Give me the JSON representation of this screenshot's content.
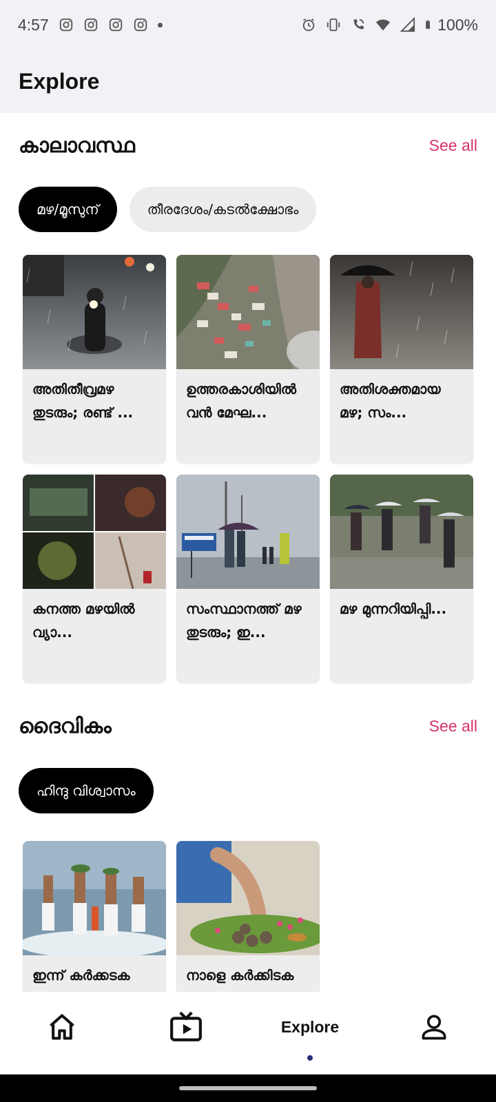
{
  "status_bar": {
    "time": "4:57",
    "notification_icons": [
      "instagram-icon",
      "instagram-icon",
      "instagram-icon",
      "instagram-icon"
    ],
    "system_icons": [
      "alarm-icon",
      "vibrate-icon",
      "wifi-calling-icon",
      "wifi-icon",
      "signal-icon",
      "battery-icon"
    ],
    "battery": "100%"
  },
  "header": {
    "title": "Explore"
  },
  "sections": [
    {
      "title": "കാലാവസ്ഥ",
      "see_all": "See all",
      "chips": [
        {
          "label": "മഴ/മൂസുന്",
          "active": true
        },
        {
          "label": "തീരദേശം/കടൽക്ഷോഭം",
          "active": false
        }
      ],
      "cards": [
        {
          "title": "അതിതീവ്രമഴ തുടരും; രണ്ട് ...",
          "image": "motorcycle-rider-in-rain"
        },
        {
          "title": "ഉത്തരകാശിയിൽ വൻ മേഘ...",
          "image": "hillside-village-landslide"
        },
        {
          "title": "അതിശക്തമായ മഴ; സം...",
          "image": "person-with-umbrella-in-rain"
        },
        {
          "title": "കനത്ത മഴയിൽ വ്യാ...",
          "image": "flood-damage-collage"
        },
        {
          "title": "സംസ്ഥാനത്ത് മഴ തുടരും; ഇ...",
          "image": "seashore-people-with-umbrellas"
        },
        {
          "title": "മഴ മുന്നറിയിപ്പി...",
          "image": "students-walking-in-rain"
        }
      ]
    },
    {
      "title": "ദൈവികം",
      "see_all": "See all",
      "chips": [
        {
          "label": "ഹിന്ദു വിശ്വാസം",
          "active": true
        }
      ],
      "cards": [
        {
          "title": "ഇന്ന് കർക്കടക വാവ് ബലി...",
          "image": "men-ritual-bath-at-sea"
        },
        {
          "title": "നാളെ കർക്കിടക വാവ് ബലി...",
          "image": "ritual-offering-on-banana-leaf"
        }
      ]
    }
  ],
  "bottom_nav": {
    "items": [
      {
        "icon": "home-icon",
        "label": ""
      },
      {
        "icon": "tv-icon",
        "label": ""
      },
      {
        "icon": "",
        "label": "Explore",
        "active": true
      },
      {
        "icon": "profile-icon",
        "label": ""
      }
    ]
  },
  "colors": {
    "accent": "#d6336c",
    "chip_active": "#000000",
    "chip_inactive": "#ececec",
    "card_bg": "#ededed",
    "header_bg": "#f2f2f6",
    "nav_dot": "#2b2f7a"
  }
}
